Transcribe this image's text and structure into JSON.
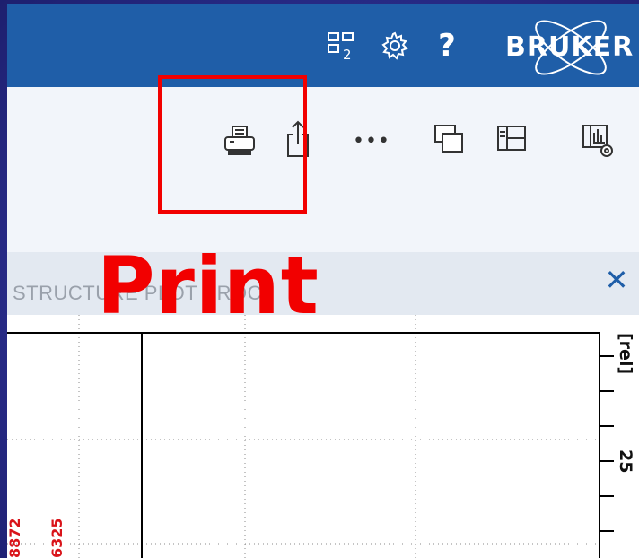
{
  "title_bar": {
    "icons": [
      "layout-2-icon",
      "gear-icon",
      "help-icon"
    ],
    "help_glyph": "?",
    "logo_text": "BRUKER"
  },
  "toolbar": {
    "buttons": [
      "print-icon",
      "export-icon",
      "more-icon",
      "window-layout-icon",
      "panel-layout-icon",
      "display-settings-icon"
    ],
    "more_label": "•••"
  },
  "panel": {
    "title": "STRUCTURE PLOT PROC",
    "close_label": "✕"
  },
  "overlay": {
    "label": "Print",
    "highlight_color": "#f20000"
  },
  "spectrum": {
    "y_axis_label": "[rel]",
    "tick_label": "25",
    "peak_labels": [
      "8872",
      "6325"
    ],
    "peak_label_color": "#d9141a"
  },
  "colors": {
    "title_bar": "#1f5ea8",
    "toolbar": "#f2f5fa",
    "panel_header": "#e3e9f1",
    "slide_background": "#2b2e8a"
  }
}
